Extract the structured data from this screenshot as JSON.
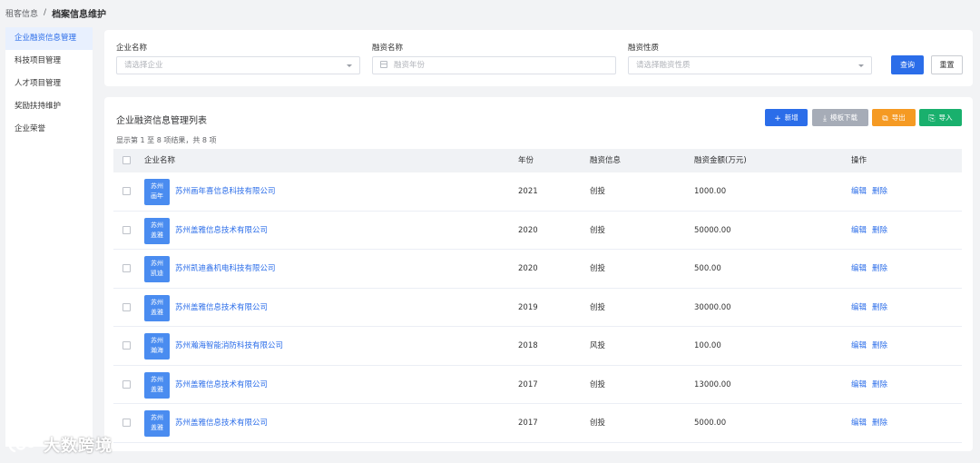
{
  "breadcrumb": {
    "parent": "租客信息",
    "separator": "/",
    "current": "档案信息维护"
  },
  "sidebar": {
    "items": [
      {
        "label": "企业融资信息管理",
        "active": true
      },
      {
        "label": "科技项目管理",
        "active": false
      },
      {
        "label": "人才项目管理",
        "active": false
      },
      {
        "label": "奖励扶持维护",
        "active": false
      },
      {
        "label": "企业荣誉",
        "active": false
      }
    ]
  },
  "filter": {
    "company_label": "企业名称",
    "company_placeholder": "请选择企业",
    "name_label": "融资名称",
    "name_placeholder": "融资年份",
    "nature_label": "融资性质",
    "nature_placeholder": "请选择融资性质",
    "query_label": "查询",
    "reset_label": "重置"
  },
  "list": {
    "title": "企业融资信息管理列表",
    "result_info": "显示第 1 至 8 项结果，共 8 项",
    "toolbar": {
      "add": "新增",
      "template": "模板下载",
      "export": "导出",
      "import": "导入"
    },
    "columns": {
      "company": "企业名称",
      "year": "年份",
      "info": "融资信息",
      "amount": "融资金额(万元)",
      "ops": "操作"
    },
    "op_edit": "编辑",
    "op_delete": "删除",
    "rows": [
      {
        "logo_l1": "苏州",
        "logo_l2": "画年",
        "company": "苏州画年喜信息科技有限公司",
        "year": "2021",
        "info": "创投",
        "amount": "1000.00"
      },
      {
        "logo_l1": "苏州",
        "logo_l2": "盖雅",
        "company": "苏州盖雅信息技术有限公司",
        "year": "2020",
        "info": "创投",
        "amount": "50000.00"
      },
      {
        "logo_l1": "苏州",
        "logo_l2": "凯迪",
        "company": "苏州凯迪鑫机电科技有限公司",
        "year": "2020",
        "info": "创投",
        "amount": "500.00"
      },
      {
        "logo_l1": "苏州",
        "logo_l2": "盖雅",
        "company": "苏州盖雅信息技术有限公司",
        "year": "2019",
        "info": "创投",
        "amount": "30000.00"
      },
      {
        "logo_l1": "苏州",
        "logo_l2": "瀚海",
        "company": "苏州瀚海智能消防科技有限公司",
        "year": "2018",
        "info": "风投",
        "amount": "100.00"
      },
      {
        "logo_l1": "苏州",
        "logo_l2": "盖雅",
        "company": "苏州盖雅信息技术有限公司",
        "year": "2017",
        "info": "创投",
        "amount": "13000.00"
      },
      {
        "logo_l1": "苏州",
        "logo_l2": "盖雅",
        "company": "苏州盖雅信息技术有限公司",
        "year": "2017",
        "info": "创投",
        "amount": "5000.00"
      }
    ]
  },
  "watermark": {
    "text": "大数跨境"
  },
  "colors": {
    "primary": "#2b6de9",
    "logo": "#4a8cf0",
    "export": "#f59a23",
    "import": "#19b06d",
    "template": "#a6acb7"
  }
}
